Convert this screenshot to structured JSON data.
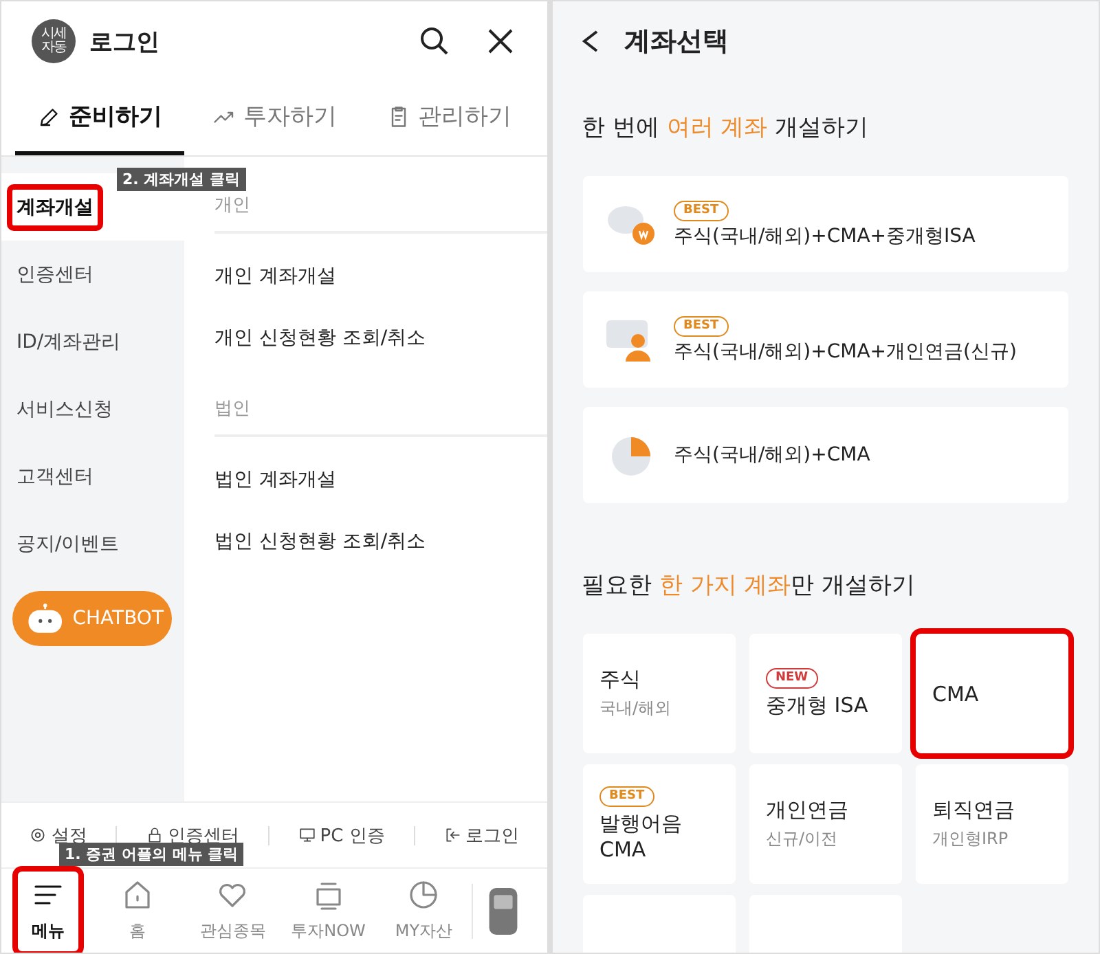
{
  "menu_screen": {
    "header": {
      "avatar_text": [
        "시세",
        "자동"
      ],
      "title": "로그인"
    },
    "tabs": [
      {
        "label": "준비하기",
        "selected": true
      },
      {
        "label": "투자하기",
        "selected": false
      },
      {
        "label": "관리하기",
        "selected": false
      }
    ],
    "sidebar": {
      "items": [
        {
          "label": "계좌개설",
          "selected": true,
          "highlighted": true
        },
        {
          "label": "인증센터",
          "selected": false,
          "highlighted": false
        },
        {
          "label": "ID/계좌관리",
          "selected": false,
          "highlighted": false
        },
        {
          "label": "서비스신청",
          "selected": false,
          "highlighted": false
        },
        {
          "label": "고객센터",
          "selected": false,
          "highlighted": false
        },
        {
          "label": "공지/이벤트",
          "selected": false,
          "highlighted": false
        }
      ],
      "chatbot": "CHATBOT"
    },
    "sections": [
      {
        "title": "개인",
        "items": [
          "개인 계좌개설",
          "개인 신청현황 조회/취소"
        ]
      },
      {
        "title": "법인",
        "items": [
          "법인 계좌개설",
          "법인 신청현황 조회/취소"
        ]
      }
    ],
    "footer_links": [
      "설정",
      "인증센터",
      "PC 인증",
      "로그인"
    ],
    "bottom_nav": [
      {
        "label": "메뉴",
        "selected": true,
        "highlighted": true
      },
      {
        "label": "홈",
        "selected": false,
        "highlighted": false
      },
      {
        "label": "관심종목",
        "selected": false,
        "highlighted": false
      },
      {
        "label": "투자NOW",
        "selected": false,
        "highlighted": false
      },
      {
        "label": "MY자산",
        "selected": false,
        "highlighted": false
      }
    ],
    "annotations": [
      "2. 계좌개설 클릭",
      "1. 증권 어플의 메뉴 클릭"
    ]
  },
  "account_screen": {
    "title": "계좌선택",
    "bundle_heading": [
      {
        "text": "한 번에 ",
        "accent": false
      },
      {
        "text": "여러 계좌",
        "accent": true
      },
      {
        "text": " 개설하기",
        "accent": false
      }
    ],
    "bundles": [
      {
        "badge": "BEST",
        "title": "주식(국내/해외)+CMA+중개형ISA"
      },
      {
        "badge": "BEST",
        "title": "주식(국내/해외)+CMA+개인연금(신규)"
      },
      {
        "title": "주식(국내/해외)+CMA"
      }
    ],
    "single_heading": [
      {
        "text": "필요한 ",
        "accent": false
      },
      {
        "text": "한 가지 계좌",
        "accent": true
      },
      {
        "text": "만 개설하기",
        "accent": false
      }
    ],
    "singles": [
      {
        "kind": "card",
        "title": "주식",
        "subtitle": "국내/해외",
        "highlighted": false
      },
      {
        "kind": "card",
        "badge": "NEW",
        "color": "#d03a3a",
        "title": "중개형 ISA",
        "highlighted": false
      },
      {
        "kind": "card",
        "title": "CMA",
        "highlighted": true
      },
      {
        "kind": "card",
        "badge": "BEST",
        "color": "#e08a1e",
        "title": "발행어음 CMA",
        "highlighted": false
      },
      {
        "kind": "card",
        "title": "개인연금",
        "subtitle": "신규/이전",
        "highlighted": false
      },
      {
        "kind": "card",
        "title": "퇴직연금",
        "subtitle": "개인형IRP",
        "highlighted": false
      },
      {
        "kind": "cut",
        "highlighted": false
      },
      {
        "kind": "cut",
        "highlighted": false
      }
    ]
  }
}
